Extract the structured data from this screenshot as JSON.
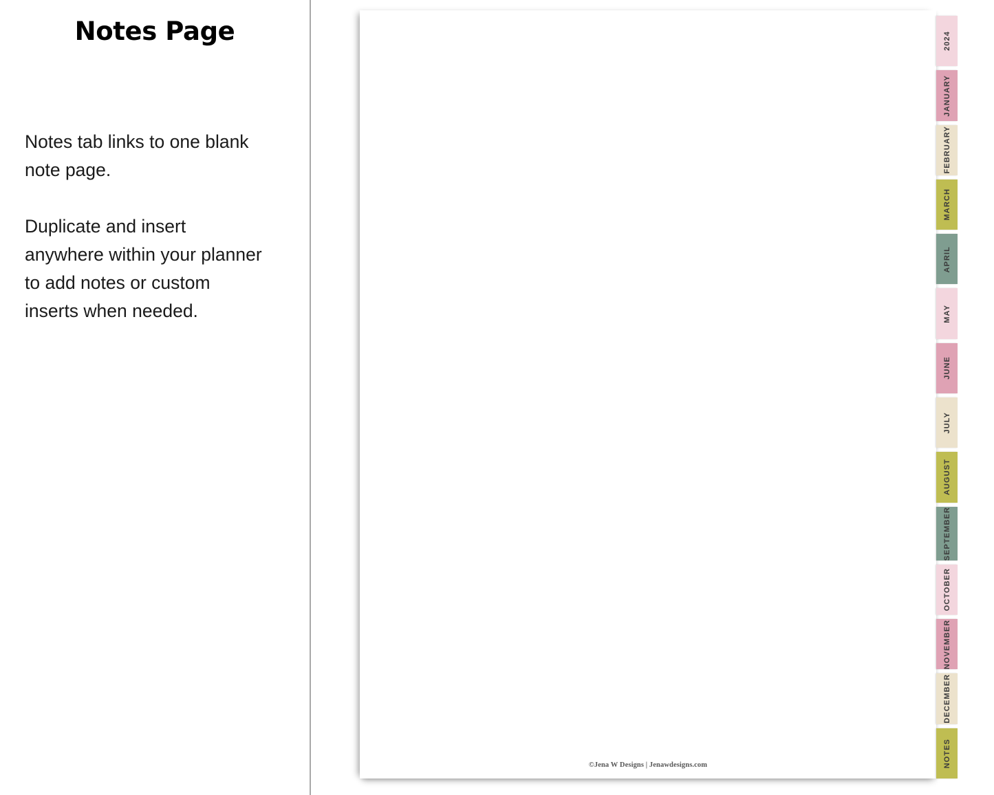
{
  "panel": {
    "title": "Notes Page",
    "paragraphs": [
      "Notes tab links to one blank note page.",
      "Duplicate and insert anywhere within your planner to add notes or custom inserts when needed."
    ]
  },
  "page": {
    "footer": "©Jena W Designs | Jenawdesigns.com"
  },
  "tabs": {
    "items": [
      {
        "label": "2024",
        "color": "#f3d6de"
      },
      {
        "label": "JANUARY",
        "color": "#dfa2b4"
      },
      {
        "label": "FEBRUARY",
        "color": "#ece2cc"
      },
      {
        "label": "MARCH",
        "color": "#bfbd52"
      },
      {
        "label": "APRIL",
        "color": "#7f9d90"
      },
      {
        "label": "MAY",
        "color": "#f3d6de"
      },
      {
        "label": "JUNE",
        "color": "#dfa2b4"
      },
      {
        "label": "JULY",
        "color": "#ece2cc"
      },
      {
        "label": "AUGUST",
        "color": "#bfbd52"
      },
      {
        "label": "SEPTEMBER",
        "color": "#7f9d90"
      },
      {
        "label": "OCTOBER",
        "color": "#f3d6de"
      },
      {
        "label": "NOVEMBER",
        "color": "#dfa2b4"
      },
      {
        "label": "DECEMBER",
        "color": "#ece2cc"
      },
      {
        "label": "NOTES",
        "color": "#bfbd52"
      }
    ]
  }
}
